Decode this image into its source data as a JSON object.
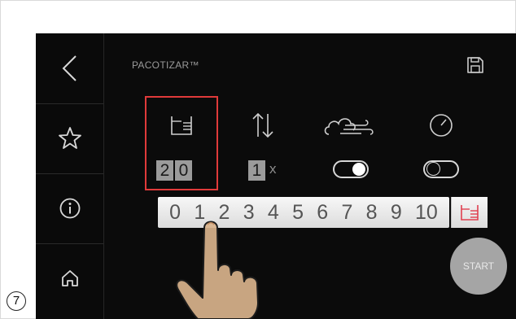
{
  "header": {
    "title": "PACOTIZAR™",
    "save_icon": "floppy-disk-icon"
  },
  "sidebar": {
    "items": [
      {
        "name": "back",
        "icon": "chevron-left-icon"
      },
      {
        "name": "favorites",
        "icon": "star-icon"
      },
      {
        "name": "info",
        "icon": "info-icon"
      },
      {
        "name": "home",
        "icon": "home-icon"
      }
    ]
  },
  "settings": {
    "portion": {
      "icon": "portion-container-icon",
      "digits": [
        "2",
        "0"
      ]
    },
    "repeat": {
      "icon": "up-down-arrows-icon",
      "digit": "1",
      "suffix": "x"
    },
    "air": {
      "icon": "cloud-wind-icon",
      "toggle_on": true
    },
    "pressure": {
      "icon": "gauge-icon",
      "toggle_on": false
    }
  },
  "scale": {
    "numbers": [
      "0",
      "1",
      "2",
      "3",
      "4",
      "5",
      "6",
      "7",
      "8",
      "9",
      "10"
    ],
    "end_icon": "portion-container-icon"
  },
  "start_label": "START",
  "step_number": "7",
  "colors": {
    "highlight": "#e03a3a",
    "accent": "#e04050",
    "screen": "#0b0b0b"
  }
}
